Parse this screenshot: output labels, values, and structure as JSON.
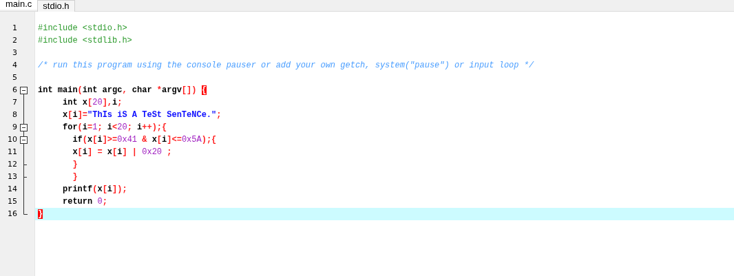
{
  "tabs": [
    {
      "label": "main.c",
      "selected": true
    },
    {
      "label": "stdio.h",
      "selected": false
    }
  ],
  "lines": [
    {
      "number": "1",
      "kind": "none",
      "tokens": [
        {
          "kind": "pre",
          "text": "#include <stdio.h>"
        }
      ]
    },
    {
      "number": "2",
      "kind": "none",
      "tokens": [
        {
          "kind": "pre",
          "text": "#include <stdlib.h>"
        }
      ]
    },
    {
      "number": "3",
      "kind": "none"
    },
    {
      "number": "4",
      "kind": "none",
      "tokens": [
        {
          "kind": "com",
          "text": "/* run this program using the console pauser or add your own getch, system(\"pause\") or input loop */"
        }
      ]
    },
    {
      "number": "5",
      "kind": "none"
    },
    {
      "number": "6",
      "kind": "start",
      "tokens": [
        {
          "kind": "plain",
          "text": "int main"
        },
        {
          "kind": "sym",
          "text": "("
        },
        {
          "kind": "plain",
          "text": "int argc"
        },
        {
          "kind": "sym",
          "text": ","
        },
        {
          "kind": "plain",
          "text": " char "
        },
        {
          "kind": "sym",
          "text": "*"
        },
        {
          "kind": "plain",
          "text": "argv"
        },
        {
          "kind": "sym",
          "text": "[]) "
        },
        {
          "kind": "match",
          "text": "{"
        }
      ]
    },
    {
      "number": "7",
      "kind": "line",
      "tokens": [
        {
          "kind": "plain",
          "text": "     int x"
        },
        {
          "kind": "sym",
          "text": "["
        },
        {
          "kind": "num",
          "text": "20"
        },
        {
          "kind": "sym",
          "text": "],"
        },
        {
          "kind": "plain",
          "text": "i"
        },
        {
          "kind": "sym",
          "text": ";"
        }
      ]
    },
    {
      "number": "8",
      "kind": "line",
      "tokens": [
        {
          "kind": "plain",
          "text": "     x"
        },
        {
          "kind": "sym",
          "text": "["
        },
        {
          "kind": "plain",
          "text": "i"
        },
        {
          "kind": "sym",
          "text": "]="
        },
        {
          "kind": "str",
          "text": "\"ThIs iS A TeSt SenTeNCe.\""
        },
        {
          "kind": "sym",
          "text": ";"
        }
      ]
    },
    {
      "number": "9",
      "kind": "nested",
      "tokens": [
        {
          "kind": "plain",
          "text": "     for"
        },
        {
          "kind": "sym",
          "text": "("
        },
        {
          "kind": "plain",
          "text": "i"
        },
        {
          "kind": "sym",
          "text": "="
        },
        {
          "kind": "num",
          "text": "1"
        },
        {
          "kind": "sym",
          "text": ";"
        },
        {
          "kind": "plain",
          "text": " i"
        },
        {
          "kind": "sym",
          "text": "<"
        },
        {
          "kind": "num",
          "text": "20"
        },
        {
          "kind": "sym",
          "text": ";"
        },
        {
          "kind": "plain",
          "text": " i"
        },
        {
          "kind": "sym",
          "text": "++);{"
        }
      ]
    },
    {
      "number": "10",
      "kind": "nested",
      "tokens": [
        {
          "kind": "plain",
          "text": "       if"
        },
        {
          "kind": "sym",
          "text": "("
        },
        {
          "kind": "plain",
          "text": "x"
        },
        {
          "kind": "sym",
          "text": "["
        },
        {
          "kind": "plain",
          "text": "i"
        },
        {
          "kind": "sym",
          "text": "]>="
        },
        {
          "kind": "num",
          "text": "0x41"
        },
        {
          "kind": "sym",
          "text": " & "
        },
        {
          "kind": "plain",
          "text": "x"
        },
        {
          "kind": "sym",
          "text": "["
        },
        {
          "kind": "plain",
          "text": "i"
        },
        {
          "kind": "sym",
          "text": "]<="
        },
        {
          "kind": "num",
          "text": "0x5A"
        },
        {
          "kind": "sym",
          "text": ");{"
        }
      ]
    },
    {
      "number": "11",
      "kind": "line",
      "tokens": [
        {
          "kind": "plain",
          "text": "       x"
        },
        {
          "kind": "sym",
          "text": "["
        },
        {
          "kind": "plain",
          "text": "i"
        },
        {
          "kind": "sym",
          "text": "] = "
        },
        {
          "kind": "plain",
          "text": "x"
        },
        {
          "kind": "sym",
          "text": "["
        },
        {
          "kind": "plain",
          "text": "i"
        },
        {
          "kind": "sym",
          "text": "] | "
        },
        {
          "kind": "num",
          "text": "0x20"
        },
        {
          "kind": "sym",
          "text": " ;"
        }
      ]
    },
    {
      "number": "12",
      "kind": "branch",
      "tokens": [
        {
          "kind": "sym",
          "text": "       }"
        }
      ]
    },
    {
      "number": "13",
      "kind": "branch",
      "tokens": [
        {
          "kind": "sym",
          "text": "       }"
        }
      ]
    },
    {
      "number": "14",
      "kind": "line",
      "tokens": [
        {
          "kind": "plain",
          "text": "     printf"
        },
        {
          "kind": "sym",
          "text": "("
        },
        {
          "kind": "plain",
          "text": "x"
        },
        {
          "kind": "sym",
          "text": "["
        },
        {
          "kind": "plain",
          "text": "i"
        },
        {
          "kind": "sym",
          "text": "]);"
        }
      ]
    },
    {
      "number": "15",
      "kind": "line",
      "tokens": [
        {
          "kind": "plain",
          "text": "     return "
        },
        {
          "kind": "num",
          "text": "0"
        },
        {
          "kind": "sym",
          "text": ";"
        }
      ]
    },
    {
      "number": "16",
      "kind": "end",
      "current": true,
      "tokens": [
        {
          "kind": "match",
          "text": "}"
        }
      ]
    }
  ]
}
